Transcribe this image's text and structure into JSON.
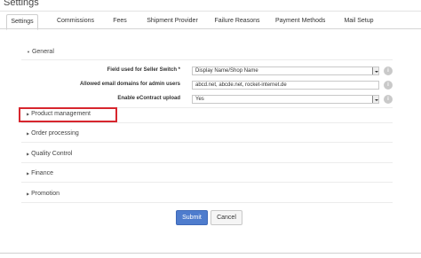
{
  "page": {
    "title": "Settings"
  },
  "tabs": [
    {
      "label": "Settings",
      "active": true
    },
    {
      "label": "Commissions"
    },
    {
      "label": "Fees"
    },
    {
      "label": "Shipment Provider"
    },
    {
      "label": "Failure Reasons"
    },
    {
      "label": "Payment Methods"
    },
    {
      "label": "Mail Setup"
    }
  ],
  "sections": {
    "general": {
      "label": "General",
      "expanded": true
    },
    "product_management": {
      "label": "Product management",
      "expanded": false,
      "highlighted": true,
      "highlight_color": "#d7262e"
    },
    "order_processing": {
      "label": "Order processing",
      "expanded": false
    },
    "quality_control": {
      "label": "Quality Control",
      "expanded": false
    },
    "finance": {
      "label": "Finance",
      "expanded": false
    },
    "promotion": {
      "label": "Promotion",
      "expanded": false
    }
  },
  "fields": {
    "seller_switch": {
      "label": "Field used for Seller Switch *",
      "value": "Display Name/Shop Name",
      "type": "select"
    },
    "email_domains": {
      "label": "Allowed email domains for admin users",
      "value": "abcd.net, abcde.net, rocket-internet.de",
      "type": "text"
    },
    "econtract_upload": {
      "label": "Enable eContract upload",
      "value": "Yes",
      "type": "select"
    }
  },
  "icons": {
    "info": "info-icon",
    "caret_expanded": "caret-down-icon",
    "caret_collapsed": "caret-right-icon"
  },
  "actions": {
    "submit_label": "Submit",
    "cancel_label": "Cancel",
    "submit_color": "#4e7ccd"
  }
}
